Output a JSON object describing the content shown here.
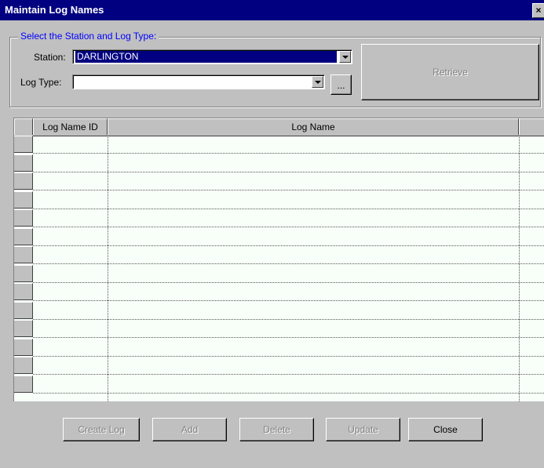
{
  "window": {
    "title": "Maintain Log Names",
    "close_glyph": "×"
  },
  "selection": {
    "legend": "Select the Station and Log Type:",
    "station_label": "Station:",
    "station_value": "DARLINGTON",
    "log_type_label": "Log Type:",
    "log_type_value": "",
    "browse_label": "...",
    "retrieve_label": "Retrieve"
  },
  "grid": {
    "columns": [
      "Log Name ID",
      "Log Name"
    ],
    "rows": [
      [
        "",
        ""
      ],
      [
        "",
        ""
      ],
      [
        "",
        ""
      ],
      [
        "",
        ""
      ],
      [
        "",
        ""
      ],
      [
        "",
        ""
      ],
      [
        "",
        ""
      ],
      [
        "",
        ""
      ],
      [
        "",
        ""
      ],
      [
        "",
        ""
      ],
      [
        "",
        ""
      ],
      [
        "",
        ""
      ],
      [
        "",
        ""
      ],
      [
        "",
        ""
      ]
    ]
  },
  "buttons": {
    "create_log": "Create Log",
    "add": "Add",
    "delete": "Delete",
    "update": "Update",
    "close": "Close"
  }
}
